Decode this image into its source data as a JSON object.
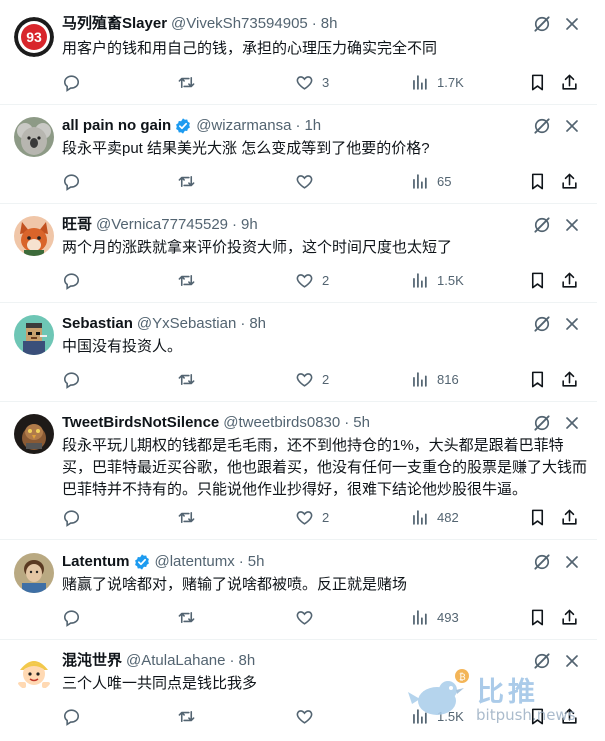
{
  "posts": [
    {
      "name": "马列殖畜Slayer",
      "handle": "@VivekSh73594905",
      "sep": "·",
      "time": "8h",
      "verified": false,
      "text": "用客户的钱和用自己的钱，承担的心理压力确实完全不同",
      "replies": "",
      "retweets": "",
      "likes": "3",
      "views": "1.7K",
      "avatar": "racing-number-93-avatar"
    },
    {
      "name": "all pain no gain",
      "handle": "@wizarmansa",
      "sep": "·",
      "time": "1h",
      "verified": true,
      "text": "段永平卖put 结果美光大涨 怎么变成等到了他要的价格?",
      "replies": "",
      "retweets": "",
      "likes": "",
      "views": "65",
      "avatar": "koala-avatar"
    },
    {
      "name": "旺哥",
      "handle": "@Vernica77745529",
      "sep": "·",
      "time": "9h",
      "verified": false,
      "text": "两个月的涨跌就拿来评价投资大师，这个时间尺度也太短了",
      "replies": "",
      "retweets": "",
      "likes": "2",
      "views": "1.5K",
      "avatar": "fox-avatar"
    },
    {
      "name": "Sebastian",
      "handle": "@YxSebastian",
      "sep": "·",
      "time": "8h",
      "verified": false,
      "text": "中国没有投资人。",
      "replies": "",
      "retweets": "",
      "likes": "2",
      "views": "816",
      "avatar": "pixel-character-avatar"
    },
    {
      "name": "TweetBirdsNotSilence",
      "handle": "@tweetbirds0830",
      "sep": "·",
      "time": "5h",
      "verified": false,
      "text": "段永平玩儿期权的钱都是毛毛雨，还不到他持仓的1%，大头都是跟着巴菲特买，巴菲特最近买谷歌，他也跟着买，他没有任何一支重仓的股票是赚了大钱而巴菲特并不持有的。只能说他作业抄得好，很难下结论他炒股很牛逼。",
      "replies": "",
      "retweets": "",
      "likes": "2",
      "views": "482",
      "avatar": "armored-bird-avatar"
    },
    {
      "name": "Latentum",
      "handle": "@latentumx",
      "sep": "·",
      "time": "5h",
      "verified": true,
      "text": "赌赢了说啥都对，赌输了说啥都被喷。反正就是赌场",
      "replies": "",
      "retweets": "",
      "likes": "",
      "views": "493",
      "avatar": "portrait-avatar"
    },
    {
      "name": "混沌世界",
      "handle": "@AtulaLahane",
      "sep": "·",
      "time": "8h",
      "verified": false,
      "text": "三个人唯一共同点是钱比我多",
      "replies": "",
      "retweets": "",
      "likes": "",
      "views": "1.5K",
      "avatar": "cartoon-emoji-avatar"
    }
  ],
  "icons": {
    "reply": "reply-icon",
    "retweet": "retweet-icon",
    "like": "heart-icon",
    "views": "views-icon",
    "bookmark": "bookmark-icon",
    "share": "share-icon",
    "grok": "grok-icon",
    "more": "more-icon",
    "verified": "verified-badge-icon"
  },
  "colors": {
    "text": "#0f1419",
    "muted": "#536471",
    "verified": "#1d9bf0",
    "divider": "#eff3f4"
  },
  "watermark": {
    "brand_cn": "比推",
    "brand_en": "bitpush.news"
  }
}
